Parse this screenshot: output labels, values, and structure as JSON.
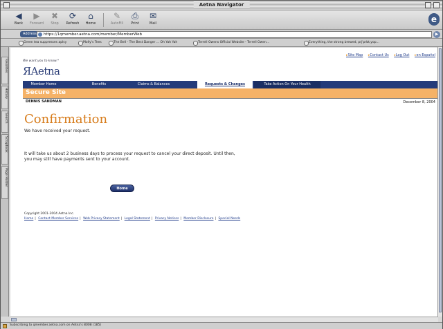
{
  "window": {
    "title": "Aetna Navigator"
  },
  "toolbar": {
    "buttons": [
      {
        "label": "Back",
        "icon": "back-arrow-icon"
      },
      {
        "label": "Forward",
        "icon": "forward-arrow-icon"
      },
      {
        "label": "Stop",
        "icon": "stop-icon"
      },
      {
        "label": "Refresh",
        "icon": "refresh-icon"
      },
      {
        "label": "Home",
        "icon": "home-icon"
      },
      {
        "label": "AutoFill",
        "icon": "autofill-icon"
      },
      {
        "label": "Print",
        "icon": "print-icon"
      },
      {
        "label": "Mail",
        "icon": "mail-icon"
      }
    ]
  },
  "address": {
    "label": "Address",
    "url": "https://1qmember.aetna.com/member/MemberWeb"
  },
  "favorites": [
    "Green tea suppresses aplsy",
    "Molly's Tees",
    "The Bell - The Best Danger ... Oh Yah Yah",
    "Terrell Owens Official Website - Terrell Owen...",
    "Everything, the strong brewed, prj'prbt,yop..."
  ],
  "side_tabs": [
    "Favorites",
    "History",
    "Search",
    "Scrapbook",
    "Page Holder"
  ],
  "header": {
    "top_links": [
      "Site Map",
      "Contact Us",
      "Log Out",
      "en Español"
    ],
    "tagline": "We want you to know.*",
    "logo": "Aetna"
  },
  "nav": [
    {
      "label": "Member Home"
    },
    {
      "label": "Benefits"
    },
    {
      "label": "Claims & Balances"
    },
    {
      "label": "Requests & Changes"
    },
    {
      "label": "Take Action On Your Health"
    }
  ],
  "secure_site": "Secure Site",
  "user": {
    "name": "DENNIS SANDMAN",
    "date": "December 8, 2004"
  },
  "main": {
    "heading": "Confirmation",
    "message": "We have received your request.",
    "detail": "It will take us about 2 business days to process your request to cancel your direct deposit. Until then, you may still have payments sent to your account.",
    "home_button": "Home"
  },
  "footer": {
    "copyright": "Copyright 2001-2004 Aetna Inc.",
    "links": [
      "Home",
      "Contact Member Services",
      "Web Privacy Statement",
      "Legal Statement",
      "Privacy Notices",
      "Member Disclosure",
      "Special Needs"
    ]
  },
  "status": {
    "text": "Subscribing to qmember.aetna.com on Aetna's 8008 (185)"
  },
  "colors": {
    "navy": "#243b7a",
    "orange": "#f5b267",
    "heading_orange": "#d77c1b"
  }
}
